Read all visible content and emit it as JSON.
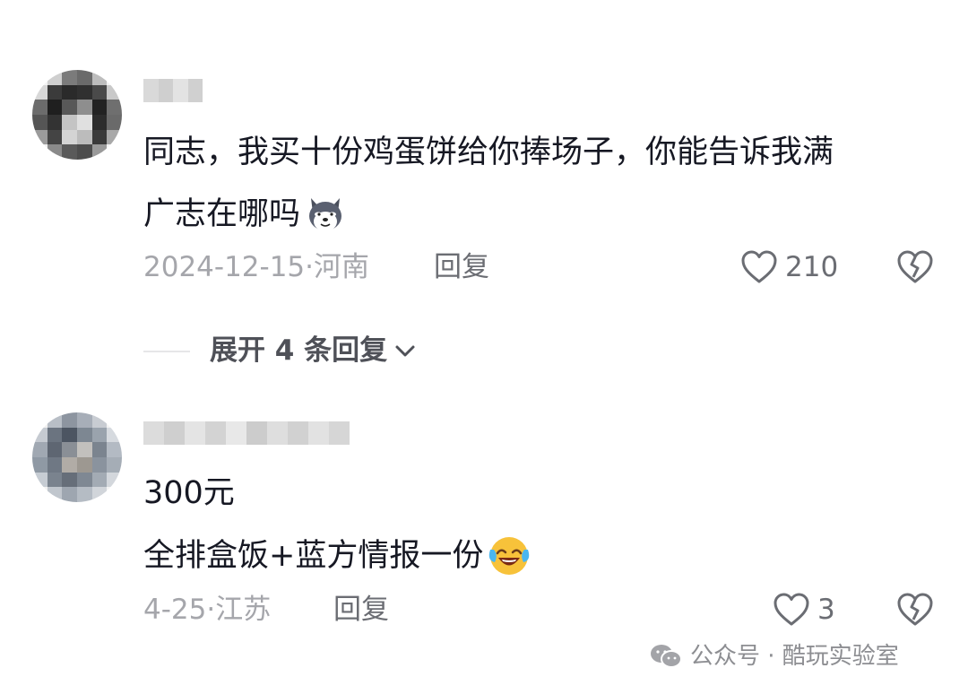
{
  "comments": [
    {
      "text_line1": "同志，我买十份鸡蛋饼给你捧场子，你能告诉我满",
      "text_line2": "广志在哪吗",
      "emoji": "dog-emoji",
      "meta": "2024-12-15·河南",
      "reply_label": "回复",
      "likes": "210"
    },
    {
      "text_line1": "300元",
      "text_line2": "全排盒饭+蓝方情报一份",
      "emoji": "laughing-crying-emoji",
      "meta": "4-25·江苏",
      "reply_label": "回复",
      "likes": "3"
    }
  ],
  "expand_replies": "展开 4 条回复",
  "watermark": "公众号 · 酷玩实验室",
  "colors": {
    "text": "#161823",
    "meta": "#a5a6ab",
    "secondary": "#6b6d73"
  }
}
